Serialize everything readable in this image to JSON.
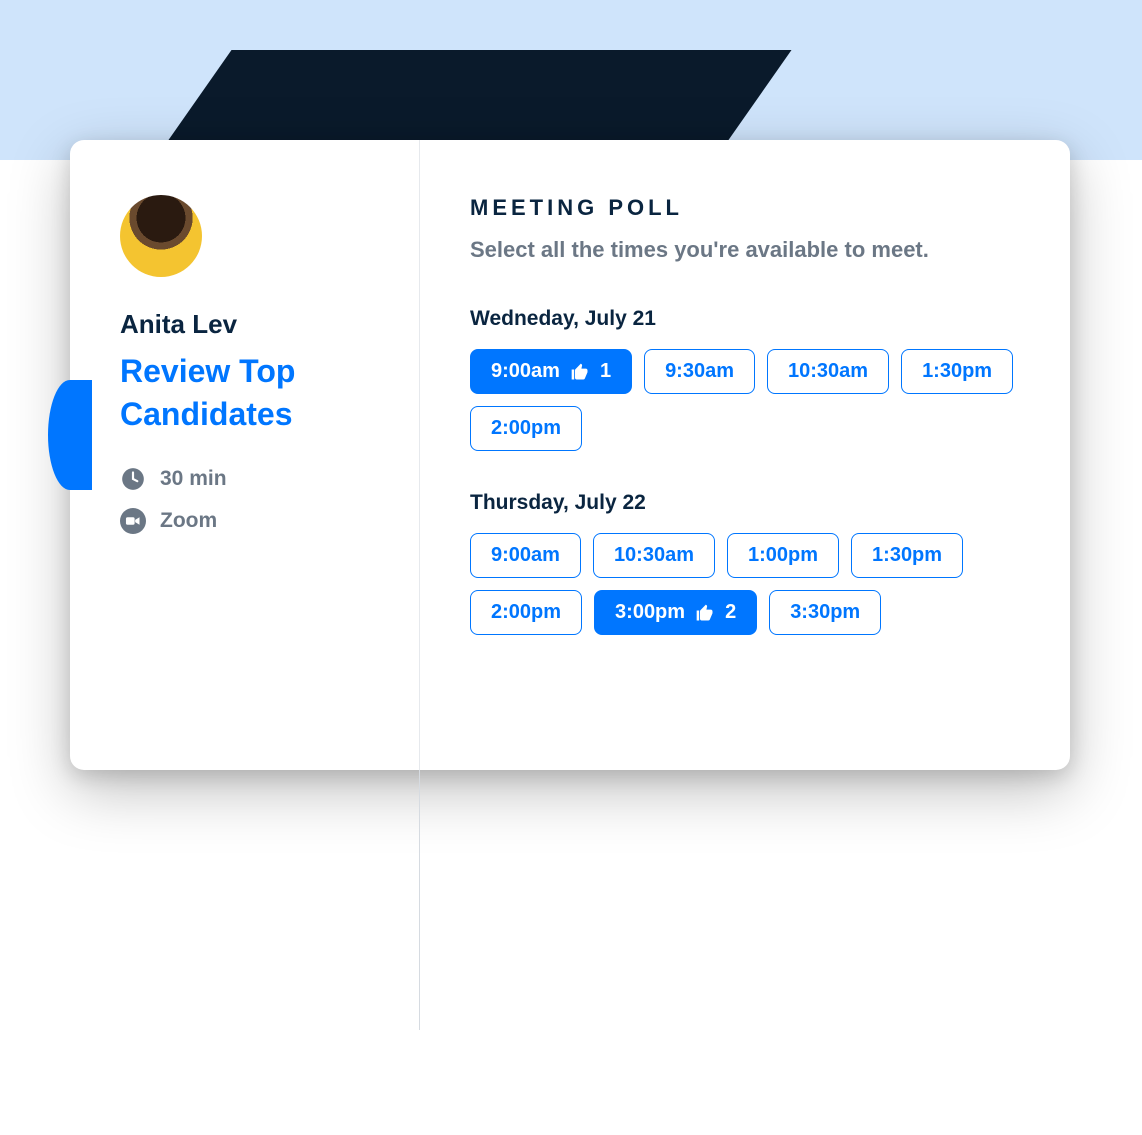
{
  "sidebar": {
    "host_name": "Anita Lev",
    "meeting_title": "Review Top Candidates",
    "duration_label": "30 min",
    "location_label": "Zoom"
  },
  "poll": {
    "title": "MEETING POLL",
    "subtitle": "Select all the times you're available to meet.",
    "days": [
      {
        "label": "Wedneday, July 21",
        "slots": [
          {
            "time": "9:00am",
            "selected": true,
            "votes": 1
          },
          {
            "time": "9:30am",
            "selected": false
          },
          {
            "time": "10:30am",
            "selected": false
          },
          {
            "time": "1:30pm",
            "selected": false
          },
          {
            "time": "2:00pm",
            "selected": false
          }
        ]
      },
      {
        "label": "Thursday, July 22",
        "slots": [
          {
            "time": "9:00am",
            "selected": false
          },
          {
            "time": "10:30am",
            "selected": false
          },
          {
            "time": "1:00pm",
            "selected": false
          },
          {
            "time": "1:30pm",
            "selected": false
          },
          {
            "time": "2:00pm",
            "selected": false
          },
          {
            "time": "3:00pm",
            "selected": true,
            "votes": 2
          },
          {
            "time": "3:30pm",
            "selected": false
          }
        ]
      }
    ]
  }
}
